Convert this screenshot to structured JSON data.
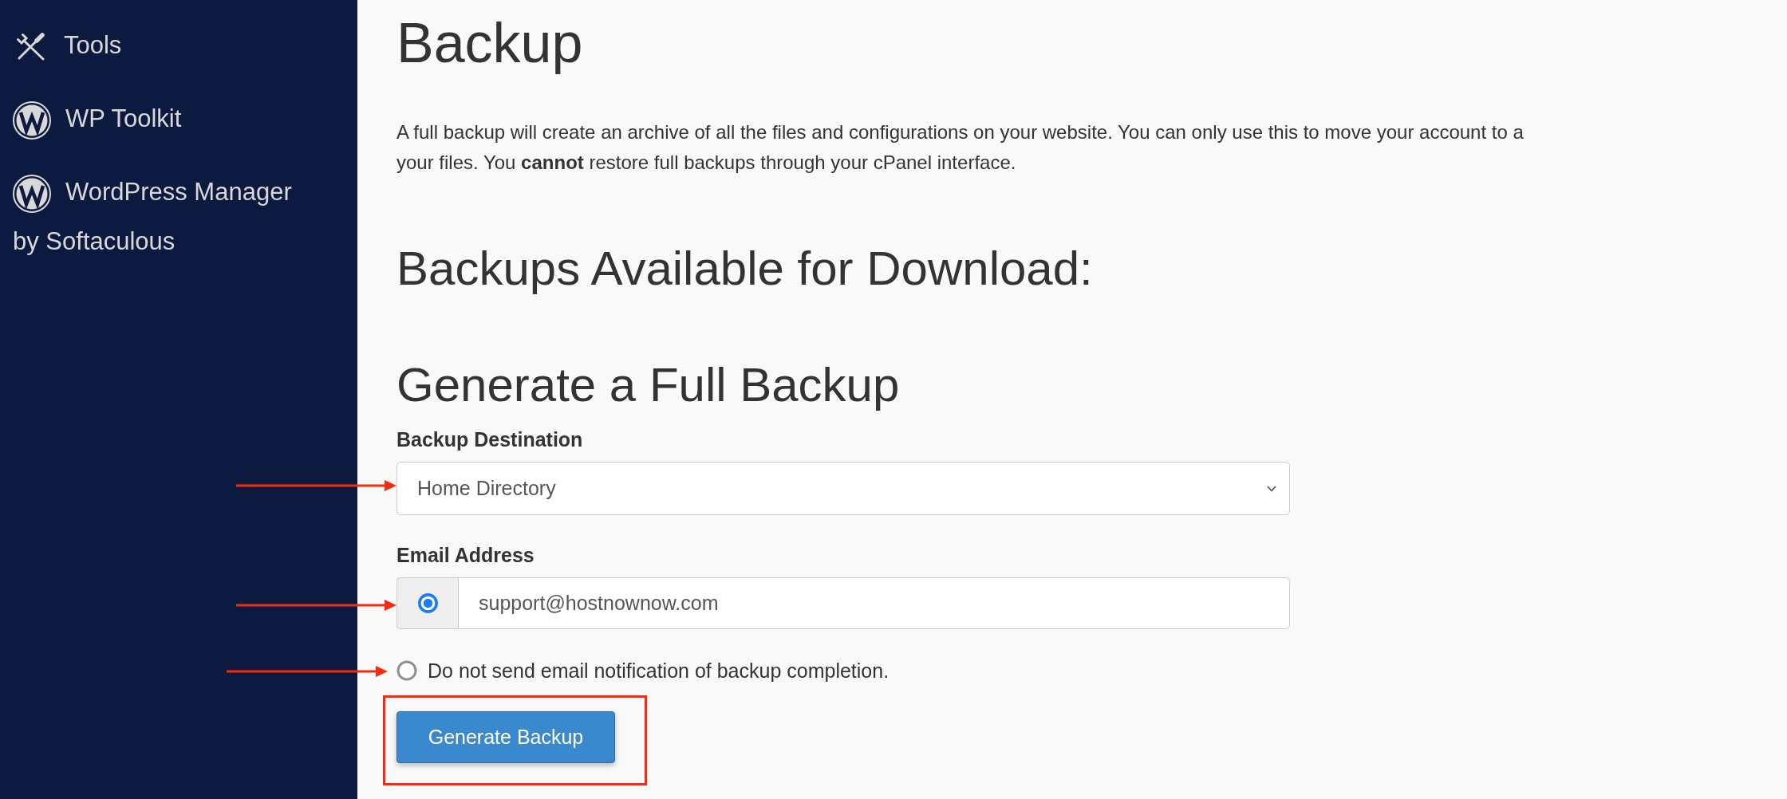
{
  "sidebar": {
    "items": [
      {
        "kind": "tools",
        "label": "Tools"
      },
      {
        "kind": "wordpress",
        "label": "WP Toolkit"
      },
      {
        "kind": "wordpress",
        "label": "WordPress Manager by Softaculous"
      }
    ]
  },
  "page": {
    "title": "Backup",
    "description": "A full backup will create an archive of all the files and configurations on your website. You can only use this to move your account to a\nyour files. You **cannot** restore full backups through your cPanel interface."
  },
  "download_section": {
    "heading": "Backups Available for Download:"
  },
  "generate_section": {
    "heading": "Generate a Full Backup",
    "destination": {
      "label": "Backup Destination",
      "value": "Home Directory"
    },
    "email": {
      "label": "Email Address",
      "options": [
        {
          "kind": "email",
          "selected": true,
          "value": "support@hostnownow.com"
        },
        {
          "kind": "none",
          "selected": false,
          "label": "Do not send email notification of backup completion."
        }
      ]
    },
    "button": "Generate Backup"
  }
}
